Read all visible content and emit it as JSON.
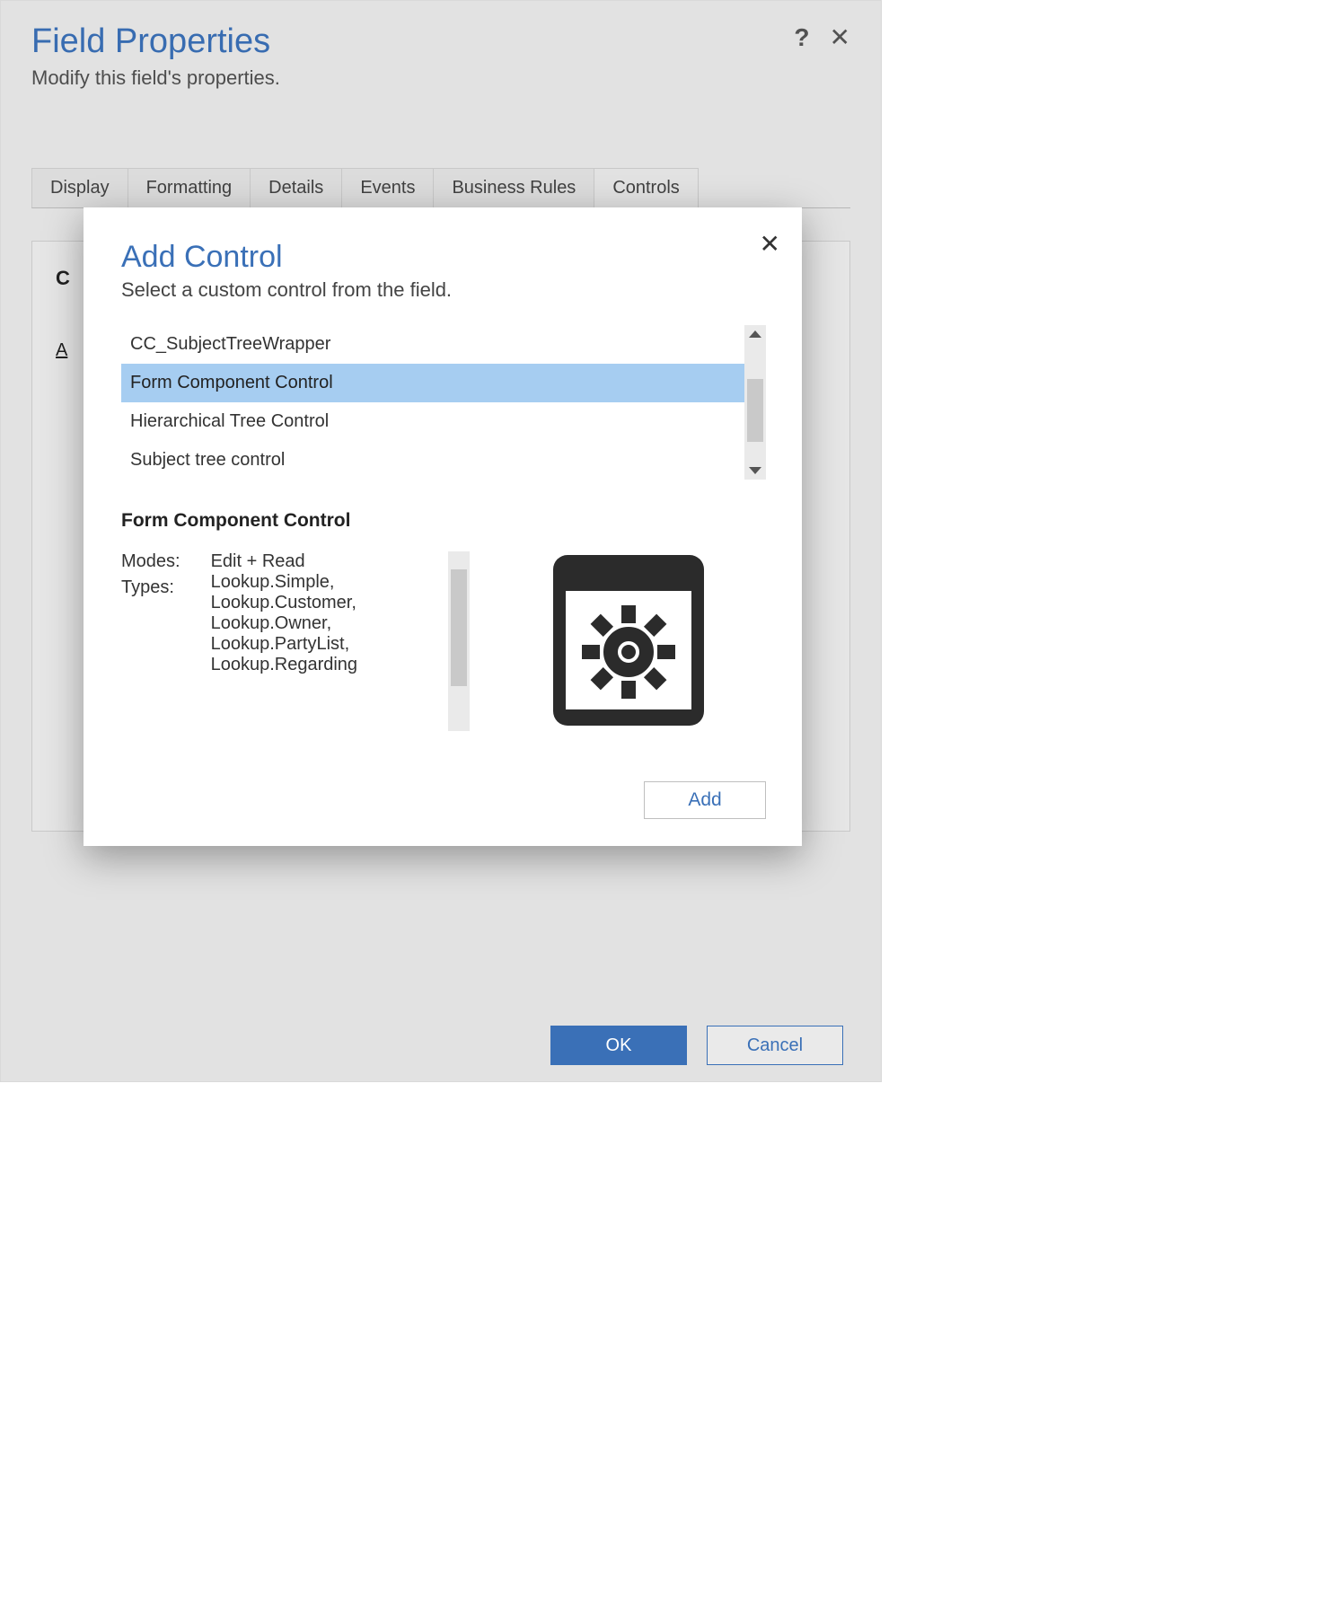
{
  "fp": {
    "title": "Field Properties",
    "subtitle": "Modify this field's properties.",
    "tabs": [
      "Display",
      "Formatting",
      "Details",
      "Events",
      "Business Rules",
      "Controls"
    ],
    "active_tab": "Controls",
    "body_heading_initial": "C",
    "body_hint_initial": "A",
    "ok": "OK",
    "cancel": "Cancel"
  },
  "modal": {
    "title": "Add Control",
    "subtitle": "Select a custom control from the field.",
    "items": [
      "CC_SubjectTreeWrapper",
      "Form Component Control",
      "Hierarchical Tree Control",
      "Subject tree control"
    ],
    "selected_index": 1,
    "detail": {
      "title": "Form Component Control",
      "modes_label": "Modes:",
      "modes": "Edit + Read",
      "types_label": "Types:",
      "types": "Lookup.Simple,\nLookup.Customer,\nLookup.Owner,\nLookup.PartyList,\nLookup.Regarding"
    },
    "add": "Add"
  }
}
